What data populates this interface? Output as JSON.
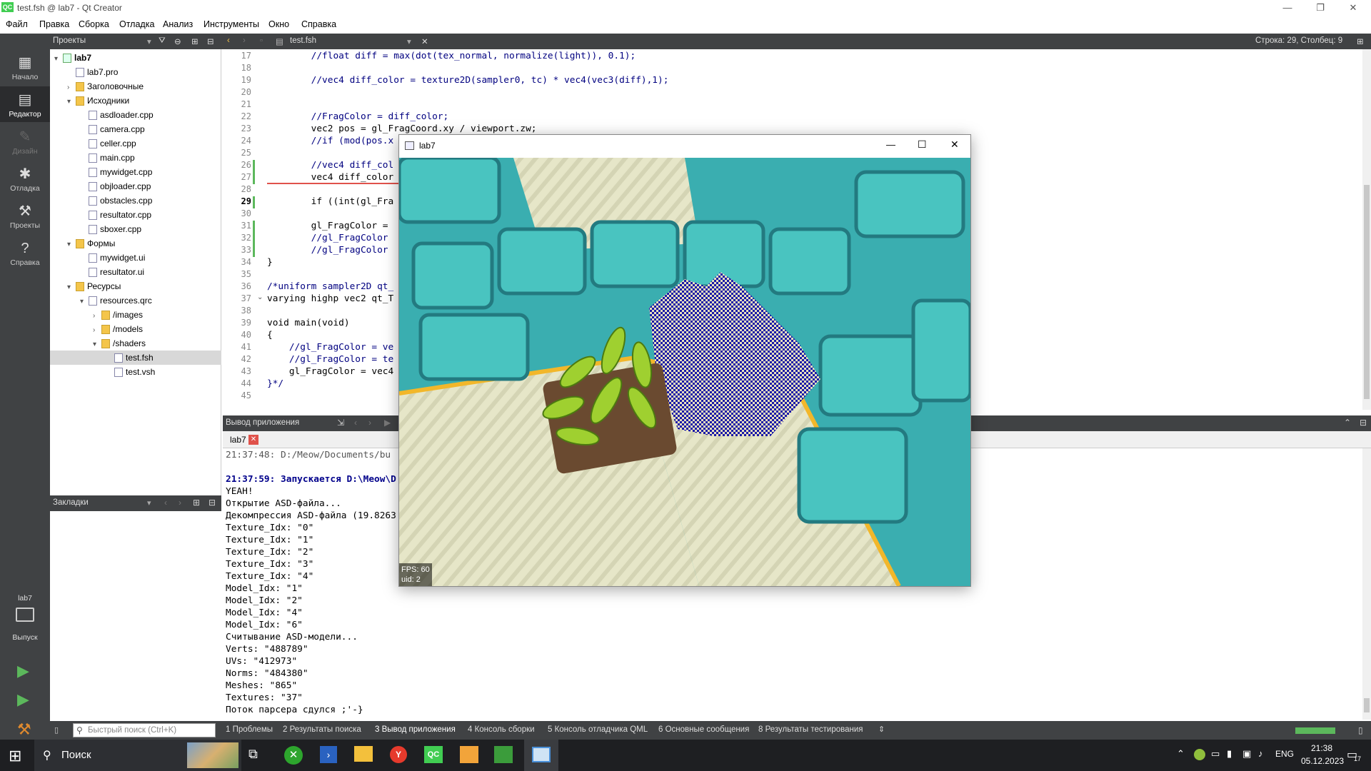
{
  "app": {
    "title": "test.fsh @ lab7 - Qt Creator",
    "logo": "QC"
  },
  "menu": [
    "Файл",
    "Правка",
    "Сборка",
    "Отладка",
    "Анализ",
    "Инструменты",
    "Окно",
    "Справка"
  ],
  "toolbar": {
    "projects_label": "Проекты",
    "file_tab": "test.fsh",
    "cursor_pos": "Строка: 29, Столбец: 9"
  },
  "modes": [
    {
      "label": "Начало",
      "icon": "grid-icon"
    },
    {
      "label": "Редактор",
      "icon": "editor-icon"
    },
    {
      "label": "Дизайн",
      "icon": "design-icon"
    },
    {
      "label": "Отладка",
      "icon": "bug-icon"
    },
    {
      "label": "Проекты",
      "icon": "wrench-icon"
    },
    {
      "label": "Справка",
      "icon": "help-icon"
    }
  ],
  "target": {
    "name": "lab7",
    "label": "Выпуск"
  },
  "tree": [
    {
      "label": "lab7",
      "depth": 0,
      "arrow": "▾",
      "icon": "proj",
      "bold": true
    },
    {
      "label": "lab7.pro",
      "depth": 1,
      "arrow": "",
      "icon": "file"
    },
    {
      "label": "Заголовочные",
      "depth": 1,
      "arrow": "›",
      "icon": "folder"
    },
    {
      "label": "Исходники",
      "depth": 1,
      "arrow": "▾",
      "icon": "folder"
    },
    {
      "label": "asdloader.cpp",
      "depth": 2,
      "arrow": "",
      "icon": "file"
    },
    {
      "label": "camera.cpp",
      "depth": 2,
      "arrow": "",
      "icon": "file"
    },
    {
      "label": "celler.cpp",
      "depth": 2,
      "arrow": "",
      "icon": "file"
    },
    {
      "label": "main.cpp",
      "depth": 2,
      "arrow": "",
      "icon": "file"
    },
    {
      "label": "mywidget.cpp",
      "depth": 2,
      "arrow": "",
      "icon": "file"
    },
    {
      "label": "objloader.cpp",
      "depth": 2,
      "arrow": "",
      "icon": "file"
    },
    {
      "label": "obstacles.cpp",
      "depth": 2,
      "arrow": "",
      "icon": "file"
    },
    {
      "label": "resultator.cpp",
      "depth": 2,
      "arrow": "",
      "icon": "file"
    },
    {
      "label": "sboxer.cpp",
      "depth": 2,
      "arrow": "",
      "icon": "file"
    },
    {
      "label": "Формы",
      "depth": 1,
      "arrow": "▾",
      "icon": "folder"
    },
    {
      "label": "mywidget.ui",
      "depth": 2,
      "arrow": "",
      "icon": "file"
    },
    {
      "label": "resultator.ui",
      "depth": 2,
      "arrow": "",
      "icon": "file"
    },
    {
      "label": "Ресурсы",
      "depth": 1,
      "arrow": "▾",
      "icon": "folder"
    },
    {
      "label": "resources.qrc",
      "depth": 2,
      "arrow": "▾",
      "icon": "file"
    },
    {
      "label": "/images",
      "depth": 3,
      "arrow": "›",
      "icon": "folder"
    },
    {
      "label": "/models",
      "depth": 3,
      "arrow": "›",
      "icon": "folder"
    },
    {
      "label": "/shaders",
      "depth": 3,
      "arrow": "▾",
      "icon": "folder"
    },
    {
      "label": "test.fsh",
      "depth": 4,
      "arrow": "",
      "icon": "file",
      "selected": true
    },
    {
      "label": "test.vsh",
      "depth": 4,
      "arrow": "",
      "icon": "file"
    }
  ],
  "bookmarks_label": "Закладки",
  "code_lines": [
    {
      "n": "17",
      "t": "        //float diff = max(dot(tex_normal, normalize(light)), 0.1);"
    },
    {
      "n": "18",
      "t": ""
    },
    {
      "n": "19",
      "t": "        //vec4 diff_color = texture2D(sampler0, tc) * vec4(vec3(diff),1);"
    },
    {
      "n": "20",
      "t": ""
    },
    {
      "n": "21",
      "t": ""
    },
    {
      "n": "22",
      "t": "        //FragColor = diff_color;"
    },
    {
      "n": "23",
      "t": "        vec2 pos = gl_FragCoord.xy / viewport.zw;"
    },
    {
      "n": "24",
      "t": "        //if (mod(pos.x"
    },
    {
      "n": "25",
      "t": ""
    },
    {
      "n": "26",
      "t": "        //vec4 diff_col"
    },
    {
      "n": "27",
      "t": "        vec4 diff_color"
    },
    {
      "n": "28",
      "t": ""
    },
    {
      "n": "29",
      "t": "        if ((int(gl_Fra"
    },
    {
      "n": "30",
      "t": ""
    },
    {
      "n": "31",
      "t": "        gl_FragColor = "
    },
    {
      "n": "32",
      "t": "        //gl_FragColor "
    },
    {
      "n": "33",
      "t": "        //gl_FragColor "
    },
    {
      "n": "34",
      "t": "}"
    },
    {
      "n": "35",
      "t": ""
    },
    {
      "n": "36",
      "t": "/*uniform sampler2D qt_"
    },
    {
      "n": "37",
      "t": "varying highp vec2 qt_T"
    },
    {
      "n": "38",
      "t": ""
    },
    {
      "n": "39",
      "t": "void main(void)"
    },
    {
      "n": "40",
      "t": "{"
    },
    {
      "n": "41",
      "t": "    //gl_FragColor = ve"
    },
    {
      "n": "42",
      "t": "    //gl_FragColor = te"
    },
    {
      "n": "43",
      "t": "    gl_FragColor = vec4"
    },
    {
      "n": "44",
      "t": "}*/"
    },
    {
      "n": "45",
      "t": ""
    }
  ],
  "output": {
    "header": "Вывод приложения",
    "tab": "lab7",
    "lines": [
      {
        "t": "21:37:48: D:/Meow/Documents/bu",
        "style": "plain"
      },
      {
        "t": "",
        "style": "plain"
      },
      {
        "t": "21:37:59: Запускается D:\\Meow\\D",
        "style": "bold"
      },
      {
        "t": "YEAH!",
        "style": "plain"
      },
      {
        "t": "Открытие ASD-файла...",
        "style": "plain"
      },
      {
        "t": "Декомпрессия ASD-файла (19.8263",
        "style": "plain"
      },
      {
        "t": "Texture_Idx: \"0\"",
        "style": "plain"
      },
      {
        "t": "Texture_Idx: \"1\"",
        "style": "plain"
      },
      {
        "t": "Texture_Idx: \"2\"",
        "style": "plain"
      },
      {
        "t": "Texture_Idx: \"3\"",
        "style": "plain"
      },
      {
        "t": "Texture_Idx: \"4\"",
        "style": "plain"
      },
      {
        "t": "Model_Idx: \"1\"",
        "style": "plain"
      },
      {
        "t": "Model_Idx: \"2\"",
        "style": "plain"
      },
      {
        "t": "Model_Idx: \"4\"",
        "style": "plain"
      },
      {
        "t": "Model_Idx: \"6\"",
        "style": "plain"
      },
      {
        "t": "Считывание ASD-модели...",
        "style": "plain"
      },
      {
        "t": "Verts: \"488789\"",
        "style": "plain"
      },
      {
        "t": "UVs: \"412973\"",
        "style": "plain"
      },
      {
        "t": "Norms: \"484380\"",
        "style": "plain"
      },
      {
        "t": "Meshes: \"865\"",
        "style": "plain"
      },
      {
        "t": "Textures: \"37\"",
        "style": "plain"
      },
      {
        "t": "Поток парсера сдулся ;'-}",
        "style": "plain"
      }
    ]
  },
  "statusbar": {
    "search_placeholder": "Быстрый поиск (Ctrl+K)",
    "tabs": [
      "1 Проблемы",
      "2 Результаты поиска",
      "3 Вывод приложения",
      "4 Консоль сборки",
      "5 Консоль отладчика QML",
      "6 Основные сообщения",
      "8 Результаты тестирования"
    ]
  },
  "lab7window": {
    "title": "lab7",
    "fps": "FPS: 60",
    "uid": "uid: 2"
  },
  "taskbar": {
    "search": "Поиск",
    "lang": "ENG",
    "time": "21:38",
    "date": "05.12.2023",
    "notif_count": "17"
  }
}
